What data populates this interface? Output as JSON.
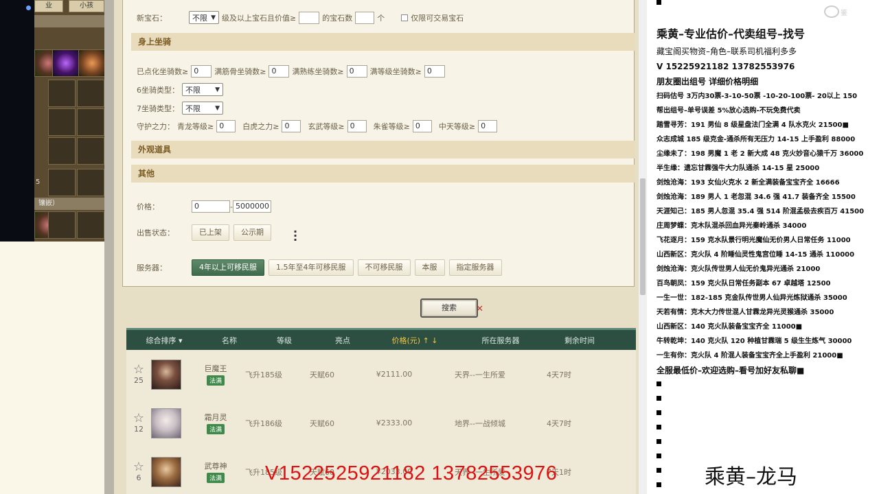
{
  "left_panel": {
    "tab_1": "业",
    "tab_2": "小孩",
    "index_label": "5",
    "bar_label": "镶嵌）"
  },
  "filters": {
    "gem": {
      "label": "新宝石：",
      "select": "不限",
      "mid_text": "级及以上宝石且价值≥",
      "gem_count_label": "的宝石数",
      "unit": "个",
      "tradable_only": "仅限可交易宝石"
    },
    "mount_section": "身上坐骑",
    "mount_row": [
      {
        "label": "已点化坐骑数≥",
        "value": "0"
      },
      {
        "label": "满筋骨坐骑数≥",
        "value": "0"
      },
      {
        "label": "满熟练坐骑数≥",
        "value": "0"
      },
      {
        "label": "满等级坐骑数≥",
        "value": "0"
      }
    ],
    "mount6": {
      "label": "6坐骑类型：",
      "select": "不限"
    },
    "mount7": {
      "label": "7坐骑类型：",
      "select": "不限"
    },
    "guard_row": {
      "label": "守护之力：",
      "items": [
        {
          "label": "青龙等级≥",
          "value": "0"
        },
        {
          "label": "白虎之力≥",
          "value": "0"
        },
        {
          "label": "玄武等级≥",
          "value": "0"
        },
        {
          "label": "朱雀等级≥",
          "value": "0"
        },
        {
          "label": "中天等级≥",
          "value": "0"
        }
      ]
    },
    "appearance_section": "外观道具",
    "other_section": "其他",
    "price": {
      "label": "价格：",
      "min": "0",
      "sep": "-",
      "max": "5000000"
    },
    "sale_status": {
      "label": "出售状态：",
      "options": [
        "已上架",
        "公示期"
      ]
    },
    "server": {
      "label": "服务器：",
      "options": [
        "4年以上可移民服",
        "1.5年至4年可移民服",
        "不可移民服",
        "本服",
        "指定服务器"
      ],
      "active_index": 0
    },
    "search_label": "搜索",
    "search_close": "✕"
  },
  "table": {
    "headers": [
      "综合排序 ▾",
      "名称",
      "等级",
      "亮点",
      "价格(元) ↑ ↓",
      "所在服务器",
      "剩余时间"
    ],
    "rows": [
      {
        "favs": "25",
        "name": "巨魔王",
        "tag": "法满",
        "level": "飞升185级",
        "highlight": "天赋60",
        "price": "¥2111.00",
        "server": "天界--一生所爱",
        "time": "4天7时"
      },
      {
        "favs": "12",
        "name": "霜月灵",
        "tag": "法满",
        "level": "飞升186级",
        "highlight": "天赋60",
        "price": "¥2333.00",
        "server": "地界--一战倾城",
        "time": "4天7时"
      },
      {
        "favs": "6",
        "name": "武尊神",
        "tag": "法满",
        "level": "飞升185级",
        "highlight": "天赋60",
        "price": "¥2033.00",
        "server": "天界--一生所爱",
        "time": "7天1时"
      }
    ]
  },
  "overlay_contact": "V1522525921182  13782553976",
  "right_ad": {
    "watermark": "鉴",
    "title": "乘黄–专业估价–代卖组号–找号",
    "lines": [
      {
        "text": "藏宝阁买物资–角色–联系司机福利多多",
        "cls": "norm"
      },
      {
        "text": "V 15225921182    13782553976",
        "cls": "mid"
      },
      {
        "text": "朋友圈出组号    详细价格明细",
        "cls": "mid"
      },
      {
        "text": "扫码估号 3万内30票-3-10-50票  -10-20-100票- 20以上 150",
        "cls": ""
      },
      {
        "text": "帮出组号–单号误差 5%放心选购-不玩免费代卖",
        "cls": ""
      },
      {
        "text": "踏雪寻芳：191 男仙 8 级星盘法门全满 4 队水克火 21500■",
        "cls": ""
      },
      {
        "text": "众志成城  185 级克金-通杀所有无压力 14-15 上手盈利 88000",
        "cls": ""
      },
      {
        "text": "尘缘未了：198 男魔 1 老 2 新大成 48 克火妙音心猿千万 36000",
        "cls": ""
      },
      {
        "text": "半生缘：遗忘甘霖强牛大力队通杀 14-15 星 25000",
        "cls": ""
      },
      {
        "text": "剑烛沧海：193 女仙火克水 2 新全满装备宝宝齐全 16666",
        "cls": ""
      },
      {
        "text": "剑烛沧海：189 男人 1 老忽混 34.6 强 41.7 装备齐全 15500",
        "cls": ""
      },
      {
        "text": "天涯知己：185 男人忽混 35.4 强 514 阶混孟极去疾百万 41500",
        "cls": ""
      },
      {
        "text": "庄周梦蝶：克木队混杀回血异光秦岭通杀 34000",
        "cls": ""
      },
      {
        "text": "飞花逐月：159 克水队景行明光魔仙无价男人日常任务 11000",
        "cls": ""
      },
      {
        "text": "山西新区：克火队 4 阶睡仙灵性鬼宫位睡 14-15 通杀 110000",
        "cls": ""
      },
      {
        "text": "剑烛沧海：克火队传世男人仙无价鬼异光通杀 21000",
        "cls": ""
      },
      {
        "text": "百鸟朝凤：159 克火队日常任务副本 67 卓越塔 12500",
        "cls": ""
      },
      {
        "text": "一生一世：182-185 克金队传世男人仙异光炼狱通杀 35000",
        "cls": ""
      },
      {
        "text": "天若有情：克木大力传世混人甘霖龙异光灵猴通杀 35000",
        "cls": ""
      },
      {
        "text": "山西新区：140 克火队装备宝宝齐全 11000■",
        "cls": ""
      },
      {
        "text": "牛转乾坤：140 克火队 120 种植甘霖瑞 5 级生生炼气 30000",
        "cls": ""
      },
      {
        "text": "一生有你：克火队 4 阶混人装备宝宝齐全上手盈利 21000■",
        "cls": ""
      },
      {
        "text": "全服最低价–欢迎选购–看号加好友私聊■",
        "cls": "mid"
      }
    ],
    "footer": "乘黄–龙马"
  }
}
